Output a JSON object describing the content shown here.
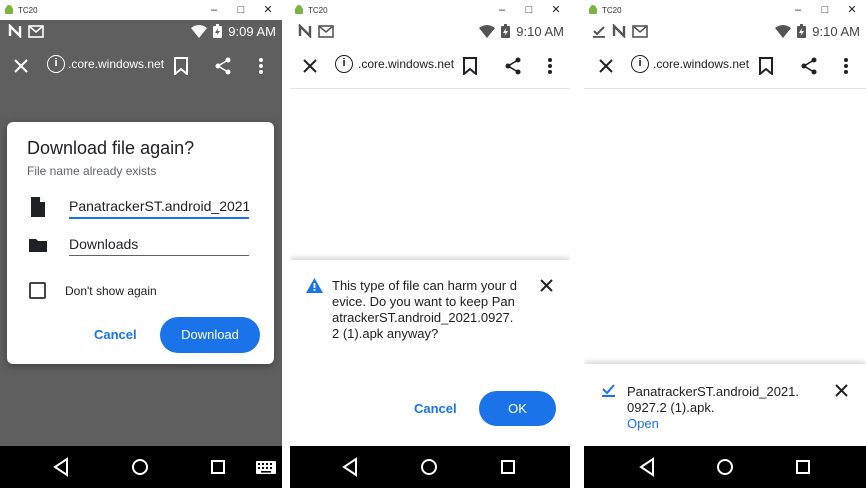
{
  "emulator": {
    "title": "TC20"
  },
  "status": {
    "p1_time": "9:09 AM",
    "p2_time": "9:10 AM",
    "p3_time": "9:10 AM"
  },
  "browser": {
    "url": ".core.windows.net"
  },
  "dialog": {
    "title": "Download file again?",
    "subtitle": "File name already exists",
    "filename": "PanatrackerST.android_2021",
    "folder": "Downloads",
    "checkbox_label": "Don't show again",
    "cancel_label": "Cancel",
    "download_label": "Download"
  },
  "warning": {
    "message": "This type of file can harm your device. Do you want to keep PanatrackerST.android_2021.0927.2 (1).apk anyway?",
    "cancel_label": "Cancel",
    "ok_label": "OK"
  },
  "complete": {
    "message": "PanatrackerST.android_2021.0927.2 (1).apk.",
    "open_label": "Open"
  },
  "colors": {
    "accent": "#1a73e8",
    "scrim": "#5f5f5f",
    "warning_icon": "#1a73e8"
  }
}
